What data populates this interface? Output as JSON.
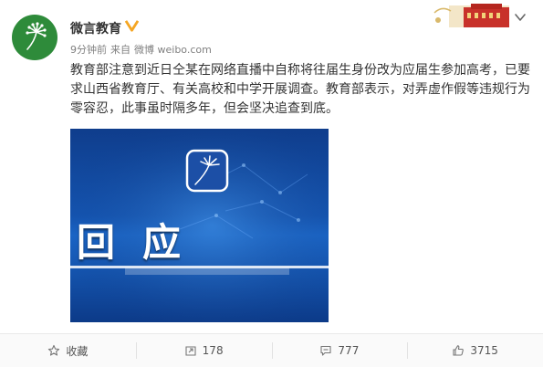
{
  "post": {
    "username": "微言教育",
    "time": "9分钟前",
    "from_label": "来自",
    "source": "微博 weibo.com",
    "text": "教育部注意到近日仝某在网络直播中自称将往届生身份改为应届生参加高考，已要求山西省教育厅、有关高校和中学开展调查。教育部表示，对弄虚作假等违规行为零容忍，此事虽时隔多年，但会坚决追查到底。",
    "image_caption": "回应"
  },
  "actions": {
    "favorite_label": "收藏",
    "repost_count": "178",
    "comment_count": "777",
    "like_count": "3715"
  },
  "colors": {
    "avatar_bg": "#2e8b3a",
    "verified": "#f5a623",
    "image_bg": "#1454b0"
  },
  "icons": {
    "verified": "verified-badge-icon",
    "chevron": "chevron-down-icon",
    "favorite": "star-icon",
    "repost": "repost-icon",
    "comment": "comment-icon",
    "like": "thumbs-up-icon"
  }
}
